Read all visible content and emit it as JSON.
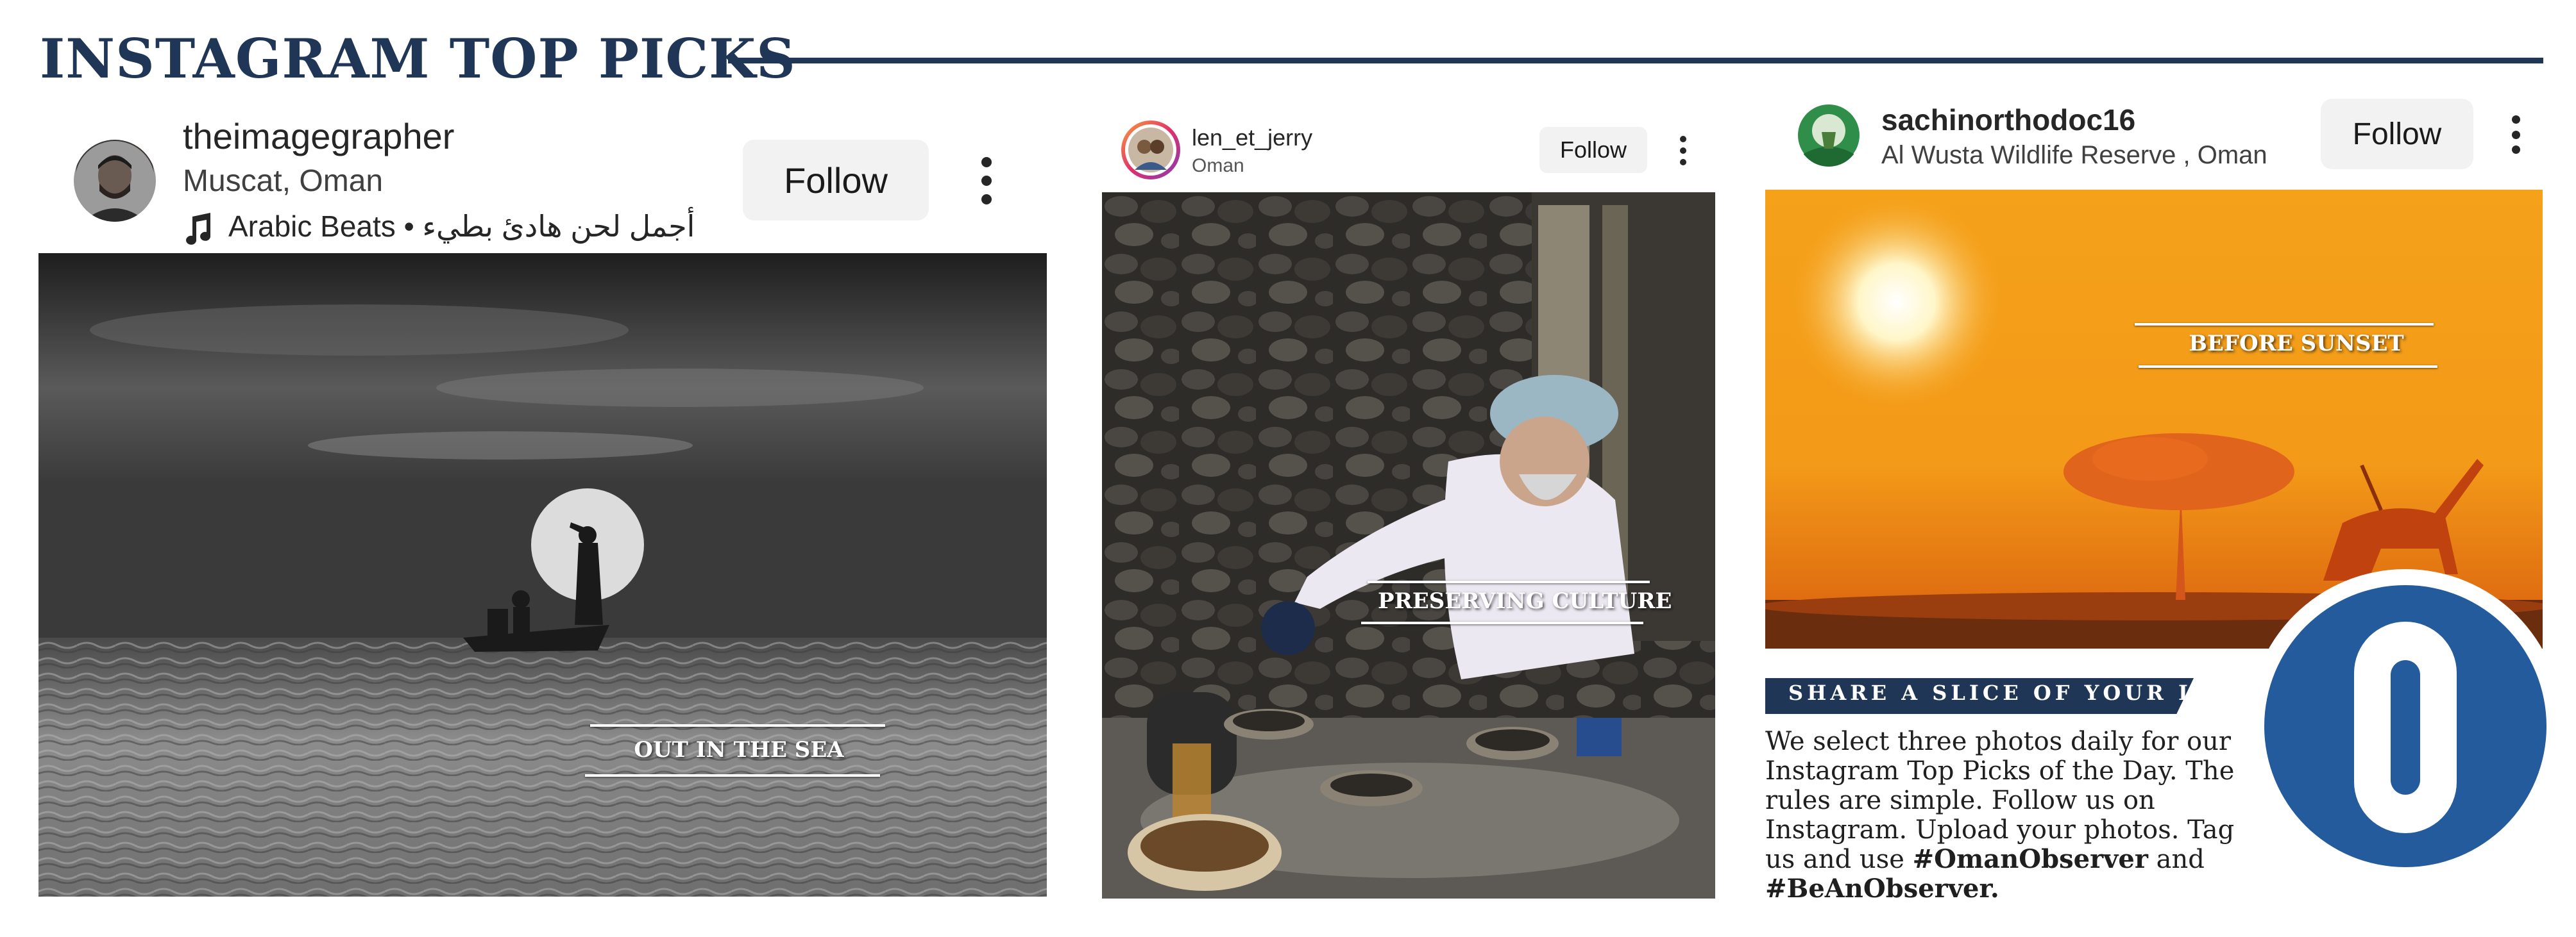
{
  "header": {
    "title": "INSTAGRAM TOP PICKS",
    "accent_color": "#1f3656"
  },
  "posts": [
    {
      "username": "theimagegrapher",
      "location": "Muscat, Oman",
      "audio": "Arabic Beats • أجمل لحن هادئ بطيء",
      "follow_label": "Follow",
      "photo_caption": "OUT IN THE SEA",
      "photo_style": "black-and-white sea with boat and moon"
    },
    {
      "username": "len_et_jerry",
      "location": "Oman",
      "follow_label": "Follow",
      "photo_caption": "PRESERVING CULTURE"
    },
    {
      "username": "sachinorthodoc16",
      "location": "Al Wusta Wildlife Reserve , Oman",
      "follow_label": "Follow",
      "photo_caption": "BEFORE SUNSET"
    }
  ],
  "promo": {
    "banner": "SHARE A SLICE OF YOUR LIFE",
    "text_plain": "We select three photos daily for our Instagram Top Picks of the Day. The rules are simple. Follow us on Instagram. Upload your photos. Tag us and use",
    "hashtag_1": "#OmanObserver",
    "and_word": "and",
    "hashtag_2": "#BeAnObserver.",
    "logo_color": "#245b9c"
  },
  "icons": [
    "music-note-icon",
    "more-options-icon",
    "avatar"
  ]
}
